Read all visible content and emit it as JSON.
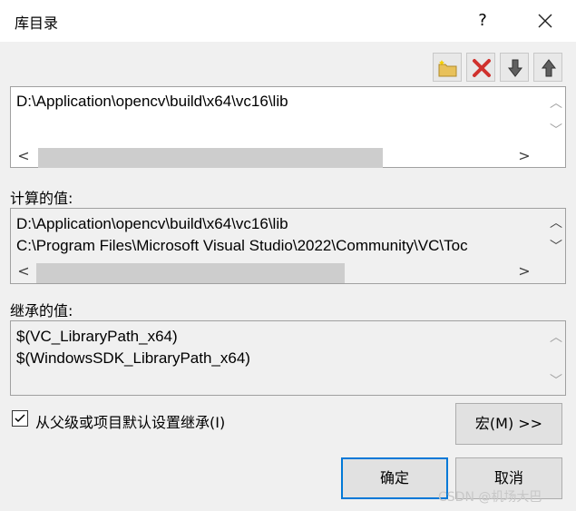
{
  "window": {
    "title": "库目录",
    "help": "?"
  },
  "toolbar": {
    "new_line": "new-folder-icon",
    "delete": "delete-icon",
    "move_down": "arrow-down-icon",
    "move_up": "arrow-up-icon"
  },
  "edit_box": {
    "lines": [
      "D:\\Application\\opencv\\build\\x64\\vc16\\lib"
    ]
  },
  "computed": {
    "label": "计算的值:",
    "lines": [
      "D:\\Application\\opencv\\build\\x64\\vc16\\lib",
      "C:\\Program Files\\Microsoft Visual Studio\\2022\\Community\\VC\\Toc"
    ]
  },
  "inherited": {
    "label": "继承的值:",
    "lines": [
      "$(VC_LibraryPath_x64)",
      "$(WindowsSDK_LibraryPath_x64)"
    ]
  },
  "inherit_checkbox": {
    "label": "从父级或项目默认设置继承(I)",
    "checked": true
  },
  "buttons": {
    "macros": "宏(M) >>",
    "ok": "确定",
    "cancel": "取消"
  },
  "watermark": "CSDN @机场大巴",
  "colors": {
    "accent": "#0078d7",
    "delete_red": "#d0312d"
  }
}
